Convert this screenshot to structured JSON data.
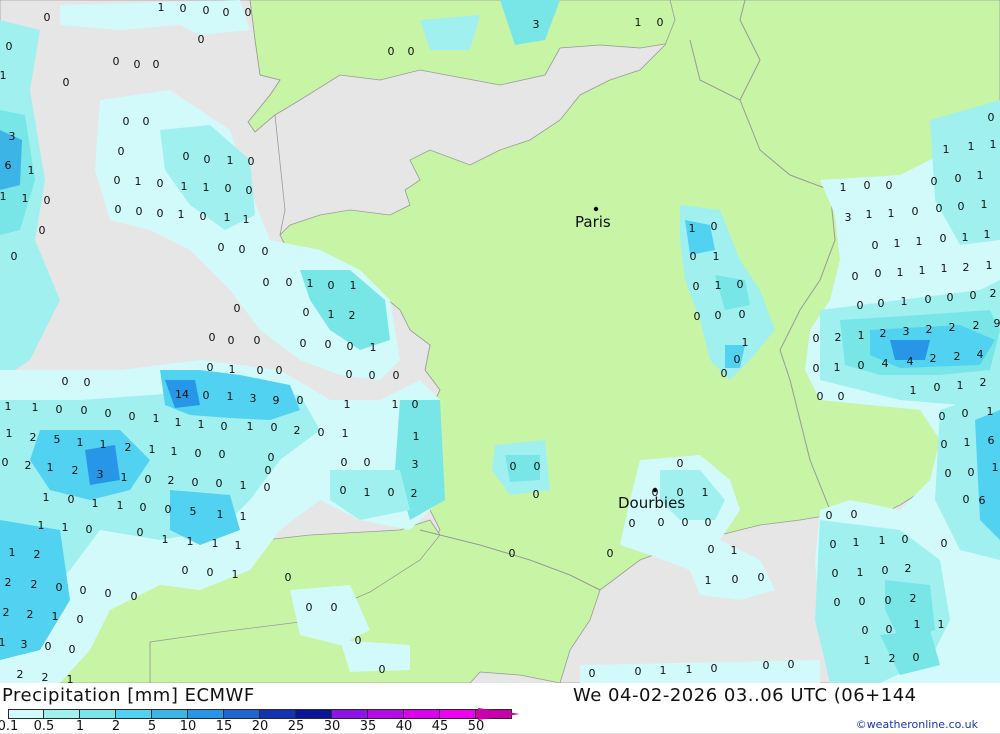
{
  "title": "Precipitation [mm] ECMWF",
  "datetime": "We 04-02-2026 03..06 UTC (06+144",
  "credit": "©weatheronline.co.uk",
  "cities": [
    {
      "name": "Paris",
      "lon": 2.35,
      "lat": 48.85
    },
    {
      "name": "Dourbies",
      "lon": 3.45,
      "lat": 44.05
    }
  ],
  "legend": {
    "ticks": [
      "0.1",
      "0.5",
      "1",
      "2",
      "5",
      "10",
      "15",
      "20",
      "25",
      "30",
      "35",
      "40",
      "45",
      "50"
    ],
    "colors": [
      "#d2fafa",
      "#a0f0f0",
      "#78e6e6",
      "#50d2f0",
      "#3cb4e6",
      "#2896e6",
      "#1e64d2",
      "#1432b4",
      "#0a1496",
      "#8c14e6",
      "#b40ae6",
      "#dc00f0",
      "#f000f0",
      "#c800aa"
    ]
  },
  "values": [
    [
      "0",
      47,
      17
    ],
    [
      "1",
      161,
      7
    ],
    [
      "0",
      183,
      8
    ],
    [
      "0",
      206,
      10
    ],
    [
      "0",
      226,
      12
    ],
    [
      "0",
      248,
      12
    ],
    [
      "3",
      536,
      24
    ],
    [
      "1",
      638,
      22
    ],
    [
      "0",
      660,
      22
    ],
    [
      "0",
      391,
      51
    ],
    [
      "0",
      411,
      51
    ],
    [
      "0",
      201,
      39
    ],
    [
      "0",
      9,
      46
    ],
    [
      "0",
      116,
      61
    ],
    [
      "0",
      137,
      64
    ],
    [
      "0",
      156,
      64
    ],
    [
      "0",
      66,
      82
    ],
    [
      "1",
      3,
      75
    ],
    [
      "3",
      12,
      136
    ],
    [
      "6",
      8,
      165
    ],
    [
      "1",
      31,
      170
    ],
    [
      "1",
      3,
      196
    ],
    [
      "1",
      25,
      198
    ],
    [
      "0",
      47,
      200
    ],
    [
      "0",
      42,
      230
    ],
    [
      "0",
      14,
      256
    ],
    [
      "0",
      126,
      121
    ],
    [
      "0",
      146,
      121
    ],
    [
      "0",
      121,
      151
    ],
    [
      "0",
      186,
      156
    ],
    [
      "0",
      207,
      159
    ],
    [
      "1",
      230,
      160
    ],
    [
      "0",
      251,
      161
    ],
    [
      "0",
      117,
      180
    ],
    [
      "1",
      138,
      181
    ],
    [
      "0",
      160,
      183
    ],
    [
      "1",
      184,
      186
    ],
    [
      "1",
      206,
      187
    ],
    [
      "0",
      228,
      188
    ],
    [
      "0",
      249,
      190
    ],
    [
      "0",
      118,
      209
    ],
    [
      "0",
      139,
      211
    ],
    [
      "0",
      160,
      213
    ],
    [
      "1",
      181,
      214
    ],
    [
      "0",
      203,
      216
    ],
    [
      "1",
      227,
      217
    ],
    [
      "1",
      246,
      219
    ],
    [
      "0",
      221,
      247
    ],
    [
      "0",
      242,
      249
    ],
    [
      "0",
      265,
      251
    ],
    [
      "0",
      266,
      282
    ],
    [
      "0",
      289,
      282
    ],
    [
      "1",
      310,
      283
    ],
    [
      "0",
      331,
      285
    ],
    [
      "1",
      353,
      285
    ],
    [
      "0",
      237,
      308
    ],
    [
      "0",
      306,
      312
    ],
    [
      "1",
      331,
      314
    ],
    [
      "2",
      352,
      315
    ],
    [
      "0",
      303,
      343
    ],
    [
      "0",
      328,
      344
    ],
    [
      "0",
      350,
      346
    ],
    [
      "1",
      373,
      347
    ],
    [
      "0",
      212,
      337
    ],
    [
      "0",
      231,
      340
    ],
    [
      "0",
      257,
      340
    ],
    [
      "0",
      210,
      367
    ],
    [
      "1",
      232,
      369
    ],
    [
      "0",
      260,
      370
    ],
    [
      "0",
      279,
      370
    ],
    [
      "0",
      349,
      374
    ],
    [
      "0",
      372,
      375
    ],
    [
      "0",
      396,
      375
    ],
    [
      "0",
      65,
      381
    ],
    [
      "0",
      87,
      382
    ],
    [
      "14",
      182,
      394
    ],
    [
      "0",
      206,
      395
    ],
    [
      "1",
      230,
      396
    ],
    [
      "3",
      253,
      398
    ],
    [
      "9",
      276,
      400
    ],
    [
      "0",
      300,
      400
    ],
    [
      "1",
      347,
      404
    ],
    [
      "1",
      395,
      404
    ],
    [
      "0",
      415,
      404
    ],
    [
      "1",
      8,
      406
    ],
    [
      "1",
      35,
      407
    ],
    [
      "0",
      59,
      409
    ],
    [
      "0",
      84,
      410
    ],
    [
      "0",
      108,
      413
    ],
    [
      "0",
      132,
      416
    ],
    [
      "1",
      156,
      418
    ],
    [
      "1",
      178,
      422
    ],
    [
      "1",
      201,
      424
    ],
    [
      "0",
      224,
      426
    ],
    [
      "1",
      250,
      426
    ],
    [
      "0",
      274,
      427
    ],
    [
      "2",
      297,
      430
    ],
    [
      "0",
      321,
      432
    ],
    [
      "1",
      345,
      433
    ],
    [
      "1",
      416,
      436
    ],
    [
      "1",
      9,
      433
    ],
    [
      "2",
      33,
      437
    ],
    [
      "5",
      57,
      439
    ],
    [
      "1",
      80,
      442
    ],
    [
      "1",
      103,
      444
    ],
    [
      "2",
      128,
      447
    ],
    [
      "1",
      152,
      449
    ],
    [
      "1",
      174,
      451
    ],
    [
      "0",
      198,
      453
    ],
    [
      "0",
      222,
      454
    ],
    [
      "0",
      271,
      457
    ],
    [
      "0",
      344,
      462
    ],
    [
      "0",
      367,
      462
    ],
    [
      "3",
      415,
      464
    ],
    [
      "0",
      5,
      462
    ],
    [
      "2",
      28,
      465
    ],
    [
      "1",
      50,
      467
    ],
    [
      "2",
      75,
      470
    ],
    [
      "3",
      100,
      474
    ],
    [
      "1",
      124,
      477
    ],
    [
      "0",
      148,
      479
    ],
    [
      "2",
      171,
      480
    ],
    [
      "0",
      195,
      482
    ],
    [
      "0",
      219,
      483
    ],
    [
      "1",
      243,
      485
    ],
    [
      "0",
      267,
      487
    ],
    [
      "0",
      268,
      470
    ],
    [
      "0",
      343,
      490
    ],
    [
      "1",
      367,
      492
    ],
    [
      "0",
      391,
      492
    ],
    [
      "2",
      414,
      493
    ],
    [
      "1",
      46,
      497
    ],
    [
      "0",
      71,
      499
    ],
    [
      "1",
      95,
      503
    ],
    [
      "1",
      120,
      505
    ],
    [
      "0",
      143,
      507
    ],
    [
      "0",
      168,
      509
    ],
    [
      "5",
      193,
      511
    ],
    [
      "1",
      220,
      514
    ],
    [
      "1",
      243,
      516
    ],
    [
      "1",
      41,
      525
    ],
    [
      "1",
      65,
      527
    ],
    [
      "0",
      89,
      529
    ],
    [
      "0",
      140,
      532
    ],
    [
      "1",
      165,
      539
    ],
    [
      "1",
      190,
      541
    ],
    [
      "1",
      215,
      543
    ],
    [
      "1",
      238,
      545
    ],
    [
      "1",
      12,
      552
    ],
    [
      "2",
      37,
      554
    ],
    [
      "0",
      185,
      570
    ],
    [
      "0",
      210,
      572
    ],
    [
      "1",
      235,
      574
    ],
    [
      "0",
      288,
      577
    ],
    [
      "2",
      8,
      582
    ],
    [
      "2",
      34,
      584
    ],
    [
      "0",
      59,
      587
    ],
    [
      "0",
      83,
      590
    ],
    [
      "0",
      108,
      593
    ],
    [
      "0",
      134,
      596
    ],
    [
      "2",
      6,
      612
    ],
    [
      "2",
      30,
      614
    ],
    [
      "1",
      55,
      616
    ],
    [
      "0",
      80,
      619
    ],
    [
      "0",
      309,
      607
    ],
    [
      "0",
      334,
      607
    ],
    [
      "1",
      2,
      642
    ],
    [
      "3",
      24,
      644
    ],
    [
      "0",
      48,
      646
    ],
    [
      "0",
      72,
      649
    ],
    [
      "0",
      358,
      640
    ],
    [
      "2",
      20,
      674
    ],
    [
      "2",
      45,
      677
    ],
    [
      "1",
      70,
      679
    ],
    [
      "0",
      382,
      669
    ],
    [
      "0",
      513,
      466
    ],
    [
      "0",
      537,
      466
    ],
    [
      "0",
      536,
      494
    ],
    [
      "0",
      512,
      553
    ],
    [
      "0",
      610,
      553
    ],
    [
      "0",
      680,
      463
    ],
    [
      "0",
      655,
      492
    ],
    [
      "0",
      680,
      492
    ],
    [
      "1",
      705,
      492
    ],
    [
      "0",
      632,
      523
    ],
    [
      "0",
      661,
      522
    ],
    [
      "0",
      685,
      522
    ],
    [
      "0",
      708,
      522
    ],
    [
      "0",
      711,
      549
    ],
    [
      "1",
      734,
      550
    ],
    [
      "1",
      708,
      580
    ],
    [
      "0",
      735,
      579
    ],
    [
      "0",
      761,
      577
    ],
    [
      "1",
      692,
      228
    ],
    [
      "0",
      714,
      226
    ],
    [
      "0",
      693,
      256
    ],
    [
      "1",
      716,
      256
    ],
    [
      "0",
      696,
      286
    ],
    [
      "1",
      718,
      285
    ],
    [
      "0",
      740,
      284
    ],
    [
      "0",
      697,
      316
    ],
    [
      "0",
      718,
      315
    ],
    [
      "0",
      742,
      314
    ],
    [
      "1",
      745,
      342
    ],
    [
      "0",
      724,
      373
    ],
    [
      "0",
      737,
      359
    ],
    [
      "1",
      843,
      187
    ],
    [
      "0",
      867,
      185
    ],
    [
      "0",
      889,
      185
    ],
    [
      "0",
      934,
      181
    ],
    [
      "0",
      958,
      178
    ],
    [
      "1",
      980,
      175
    ],
    [
      "1",
      946,
      149
    ],
    [
      "1",
      971,
      146
    ],
    [
      "1",
      993,
      144
    ],
    [
      "0",
      991,
      117
    ],
    [
      "3",
      848,
      217
    ],
    [
      "1",
      869,
      214
    ],
    [
      "1",
      891,
      213
    ],
    [
      "0",
      915,
      211
    ],
    [
      "0",
      939,
      208
    ],
    [
      "0",
      961,
      206
    ],
    [
      "1",
      984,
      204
    ],
    [
      "0",
      875,
      245
    ],
    [
      "1",
      897,
      243
    ],
    [
      "1",
      919,
      241
    ],
    [
      "0",
      943,
      238
    ],
    [
      "1",
      965,
      237
    ],
    [
      "1",
      987,
      234
    ],
    [
      "0",
      855,
      276
    ],
    [
      "0",
      878,
      273
    ],
    [
      "1",
      900,
      272
    ],
    [
      "1",
      922,
      270
    ],
    [
      "1",
      944,
      268
    ],
    [
      "2",
      966,
      267
    ],
    [
      "1",
      989,
      265
    ],
    [
      "0",
      860,
      305
    ],
    [
      "0",
      881,
      303
    ],
    [
      "1",
      904,
      301
    ],
    [
      "0",
      928,
      299
    ],
    [
      "0",
      950,
      297
    ],
    [
      "0",
      973,
      295
    ],
    [
      "2",
      993,
      293
    ],
    [
      "0",
      816,
      338
    ],
    [
      "2",
      838,
      337
    ],
    [
      "1",
      861,
      335
    ],
    [
      "2",
      883,
      333
    ],
    [
      "3",
      906,
      331
    ],
    [
      "2",
      929,
      329
    ],
    [
      "2",
      952,
      327
    ],
    [
      "2",
      976,
      325
    ],
    [
      "9",
      997,
      323
    ],
    [
      "0",
      816,
      368
    ],
    [
      "1",
      837,
      367
    ],
    [
      "0",
      861,
      365
    ],
    [
      "4",
      885,
      363
    ],
    [
      "4",
      910,
      361
    ],
    [
      "2",
      933,
      358
    ],
    [
      "2",
      957,
      356
    ],
    [
      "4",
      980,
      354
    ],
    [
      "0",
      820,
      396
    ],
    [
      "0",
      841,
      396
    ],
    [
      "1",
      913,
      390
    ],
    [
      "0",
      937,
      387
    ],
    [
      "1",
      960,
      385
    ],
    [
      "2",
      983,
      382
    ],
    [
      "0",
      942,
      416
    ],
    [
      "0",
      965,
      413
    ],
    [
      "1",
      990,
      411
    ],
    [
      "0",
      944,
      444
    ],
    [
      "1",
      967,
      442
    ],
    [
      "6",
      991,
      440
    ],
    [
      "0",
      948,
      473
    ],
    [
      "0",
      971,
      472
    ],
    [
      "1",
      995,
      467
    ],
    [
      "0",
      966,
      499
    ],
    [
      "6",
      982,
      500
    ],
    [
      "0",
      829,
      515
    ],
    [
      "0",
      854,
      514
    ],
    [
      "0",
      833,
      544
    ],
    [
      "1",
      856,
      542
    ],
    [
      "1",
      882,
      540
    ],
    [
      "0",
      905,
      539
    ],
    [
      "0",
      944,
      543
    ],
    [
      "0",
      835,
      573
    ],
    [
      "1",
      860,
      572
    ],
    [
      "0",
      885,
      570
    ],
    [
      "2",
      908,
      568
    ],
    [
      "0",
      837,
      602
    ],
    [
      "0",
      862,
      601
    ],
    [
      "0",
      888,
      600
    ],
    [
      "2",
      913,
      598
    ],
    [
      "1",
      917,
      624
    ],
    [
      "1",
      941,
      624
    ],
    [
      "0",
      865,
      630
    ],
    [
      "0",
      889,
      629
    ],
    [
      "1",
      867,
      660
    ],
    [
      "2",
      892,
      658
    ],
    [
      "0",
      916,
      657
    ],
    [
      "0",
      592,
      673
    ],
    [
      "0",
      638,
      671
    ],
    [
      "1",
      663,
      670
    ],
    [
      "1",
      689,
      669
    ],
    [
      "0",
      714,
      668
    ],
    [
      "0",
      766,
      665
    ],
    [
      "0",
      791,
      664
    ]
  ]
}
